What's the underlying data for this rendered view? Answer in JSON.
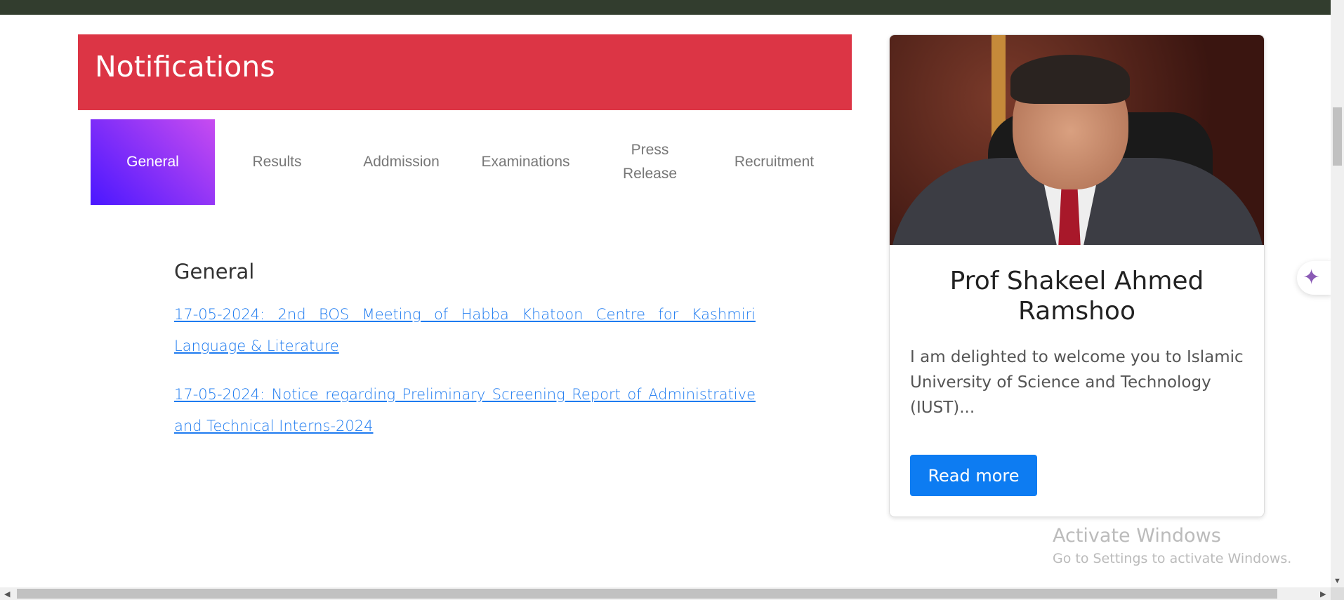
{
  "header": {
    "title": "Notifications"
  },
  "tabs": [
    {
      "label": "General",
      "active": true
    },
    {
      "label": "Results"
    },
    {
      "label": "Addmission"
    },
    {
      "label": "Examinations"
    },
    {
      "label": "Press Release"
    },
    {
      "label": "Recruitment"
    }
  ],
  "content": {
    "heading": "General",
    "links": [
      "17-05-2024: 2nd BOS Meeting of Habba Khatoon Centre for Kashmiri Language & Literature",
      "17-05-2024: Notice regarding Preliminary Screening Report of Administrative and Technical Interns-2024"
    ]
  },
  "card": {
    "name": "Prof Shakeel Ahmed Ramshoo",
    "description": "I am delighted to welcome you to Islamic University of Science and Technology (IUST)...",
    "button": "Read more"
  },
  "watermark": {
    "line1": "Activate Windows",
    "line2": "Go to Settings to activate Windows."
  },
  "colors": {
    "header": "#dc3545",
    "link": "#1e7bf0",
    "button": "#0d7cf2",
    "topbar": "#323d2e"
  }
}
